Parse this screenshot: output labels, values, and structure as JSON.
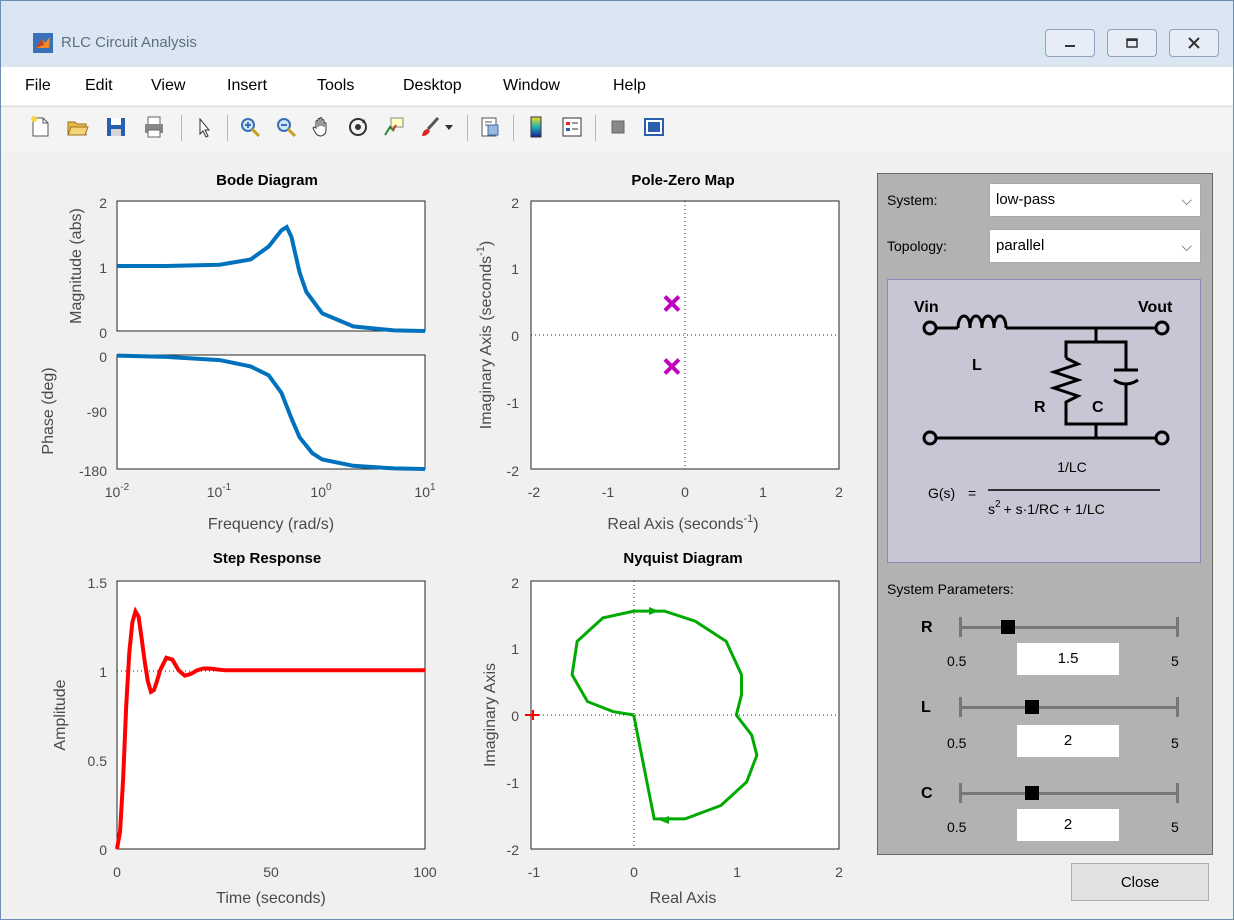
{
  "window": {
    "title": "RLC Circuit Analysis"
  },
  "menu": [
    "File",
    "Edit",
    "View",
    "Insert",
    "Tools",
    "Desktop",
    "Window",
    "Help"
  ],
  "toolbar_icons": [
    "new-file-icon",
    "open-folder-icon",
    "save-icon",
    "print-icon",
    "pointer-icon",
    "zoom-in-icon",
    "zoom-out-icon",
    "pan-hand-icon",
    "rotate-3d-icon",
    "data-cursor-icon",
    "brush-icon",
    "dropdown-arrow-icon",
    "link-plot-icon",
    "colorbar-icon",
    "legend-icon",
    "hide-plot-tools-icon",
    "show-plot-tools-icon"
  ],
  "panel": {
    "system_label": "System:",
    "system_value": "low-pass",
    "topology_label": "Topology:",
    "topology_value": "parallel",
    "params_label": "System Parameters:",
    "circuit": {
      "vin": "Vin",
      "vout": "Vout",
      "L": "L",
      "R": "R",
      "C": "C",
      "gs": "G(s)",
      "eq": "=",
      "num": "1/LC",
      "den_s": "s",
      "den_exp": "2",
      "den_rest": "+ s·1/RC + 1/LC"
    },
    "sliders": [
      {
        "name": "R",
        "value": "1.5",
        "min": "0.5",
        "max": "5",
        "fraction": 0.222
      },
      {
        "name": "L",
        "value": "2",
        "min": "0.5",
        "max": "5",
        "fraction": 0.333
      },
      {
        "name": "C",
        "value": "2",
        "min": "0.5",
        "max": "5",
        "fraction": 0.333
      }
    ],
    "close_label": "Close"
  },
  "chart_data": [
    {
      "type": "line",
      "title": "Bode Diagram",
      "xlabel": "Frequency (rad/s)",
      "xscale": "log",
      "xlim": [
        0.01,
        10
      ],
      "x_ticks": [
        "10-2",
        "10-1",
        "100",
        "101"
      ],
      "panels": [
        {
          "ylabel": "Magnitude (abs)",
          "ylim": [
            0,
            2
          ],
          "y_ticks": [
            "2",
            "1",
            "0"
          ],
          "series": [
            {
              "x": [
                0.01,
                0.03,
                0.1,
                0.2,
                0.3,
                0.4,
                0.45,
                0.5,
                0.6,
                0.7,
                1,
                2,
                5,
                10
              ],
              "y": [
                1.0,
                1.0,
                1.02,
                1.1,
                1.3,
                1.55,
                1.6,
                1.45,
                0.9,
                0.6,
                0.27,
                0.07,
                0.01,
                0.0
              ]
            }
          ]
        },
        {
          "ylabel": "Phase (deg)",
          "ylim": [
            -180,
            0
          ],
          "y_ticks": [
            "0",
            "-90",
            "-180"
          ],
          "series": [
            {
              "x": [
                0.01,
                0.03,
                0.1,
                0.2,
                0.3,
                0.4,
                0.5,
                0.6,
                0.8,
                1,
                2,
                5,
                10
              ],
              "y": [
                -1,
                -3,
                -8,
                -18,
                -32,
                -60,
                -100,
                -130,
                -155,
                -165,
                -175,
                -179,
                -180
              ]
            }
          ]
        }
      ],
      "color": "#0072bd"
    },
    {
      "type": "scatter",
      "title": "Pole-Zero Map",
      "xlabel": "Real Axis (seconds",
      "ylabel": "Imaginary Axis (seconds",
      "label_exp": "-1",
      "label_close": ")",
      "xlim": [
        -2,
        2
      ],
      "ylim": [
        -2,
        2
      ],
      "x_ticks": [
        "-2",
        "-1",
        "0",
        "1",
        "2"
      ],
      "y_ticks": [
        "2",
        "1",
        "0",
        "-1",
        "-2"
      ],
      "points": [
        {
          "x": -0.17,
          "y": 0.47
        },
        {
          "x": -0.17,
          "y": -0.47
        }
      ],
      "marker": "x",
      "color": "#bf00bf"
    },
    {
      "type": "line",
      "title": "Step Response",
      "xlabel": "Time (seconds)",
      "ylabel": "Amplitude",
      "xlim": [
        0,
        100
      ],
      "ylim": [
        0,
        1.5
      ],
      "x_ticks": [
        "0",
        "50",
        "100"
      ],
      "y_ticks": [
        "1.5",
        "1",
        "0.5",
        "0"
      ],
      "series": [
        {
          "x": [
            0,
            1,
            2,
            3,
            4,
            5,
            6,
            7,
            8,
            9,
            10,
            11,
            12,
            13,
            14,
            16,
            18,
            20,
            22,
            24,
            26,
            28,
            30,
            35,
            40,
            50,
            60,
            80,
            100
          ],
          "y": [
            0,
            0.1,
            0.4,
            0.8,
            1.1,
            1.27,
            1.33,
            1.3,
            1.18,
            1.05,
            0.94,
            0.88,
            0.89,
            0.94,
            1.0,
            1.07,
            1.06,
            1.0,
            0.97,
            0.98,
            1.0,
            1.01,
            1.01,
            1.0,
            1.0,
            1.0,
            1.0,
            1.0,
            1.0
          ]
        }
      ],
      "color": "#ff0000"
    },
    {
      "type": "line",
      "title": "Nyquist Diagram",
      "xlabel": "Real Axis",
      "ylabel": "Imaginary Axis",
      "xlim": [
        -1,
        2
      ],
      "ylim": [
        -2,
        2
      ],
      "x_ticks": [
        "-1",
        "0",
        "1",
        "2"
      ],
      "y_ticks": [
        "2",
        "1",
        "0",
        "-1",
        "-2"
      ],
      "series": [
        {
          "x": [
            0,
            -0.2,
            -0.45,
            -0.6,
            -0.55,
            -0.3,
            0,
            0.3,
            0.6,
            0.9,
            1.05,
            1.05,
            1.0,
            1.15,
            1.2,
            1.1,
            0.85,
            0.5,
            0.2,
            0
          ],
          "y": [
            0,
            0.05,
            0.2,
            0.6,
            1.1,
            1.45,
            1.55,
            1.55,
            1.4,
            1.1,
            0.6,
            0.3,
            0,
            -0.3,
            -0.6,
            -1.0,
            -1.35,
            -1.55,
            -1.55,
            0
          ]
        }
      ],
      "color": "#00aa00",
      "critical_point": {
        "x": -1,
        "y": 0
      }
    }
  ]
}
